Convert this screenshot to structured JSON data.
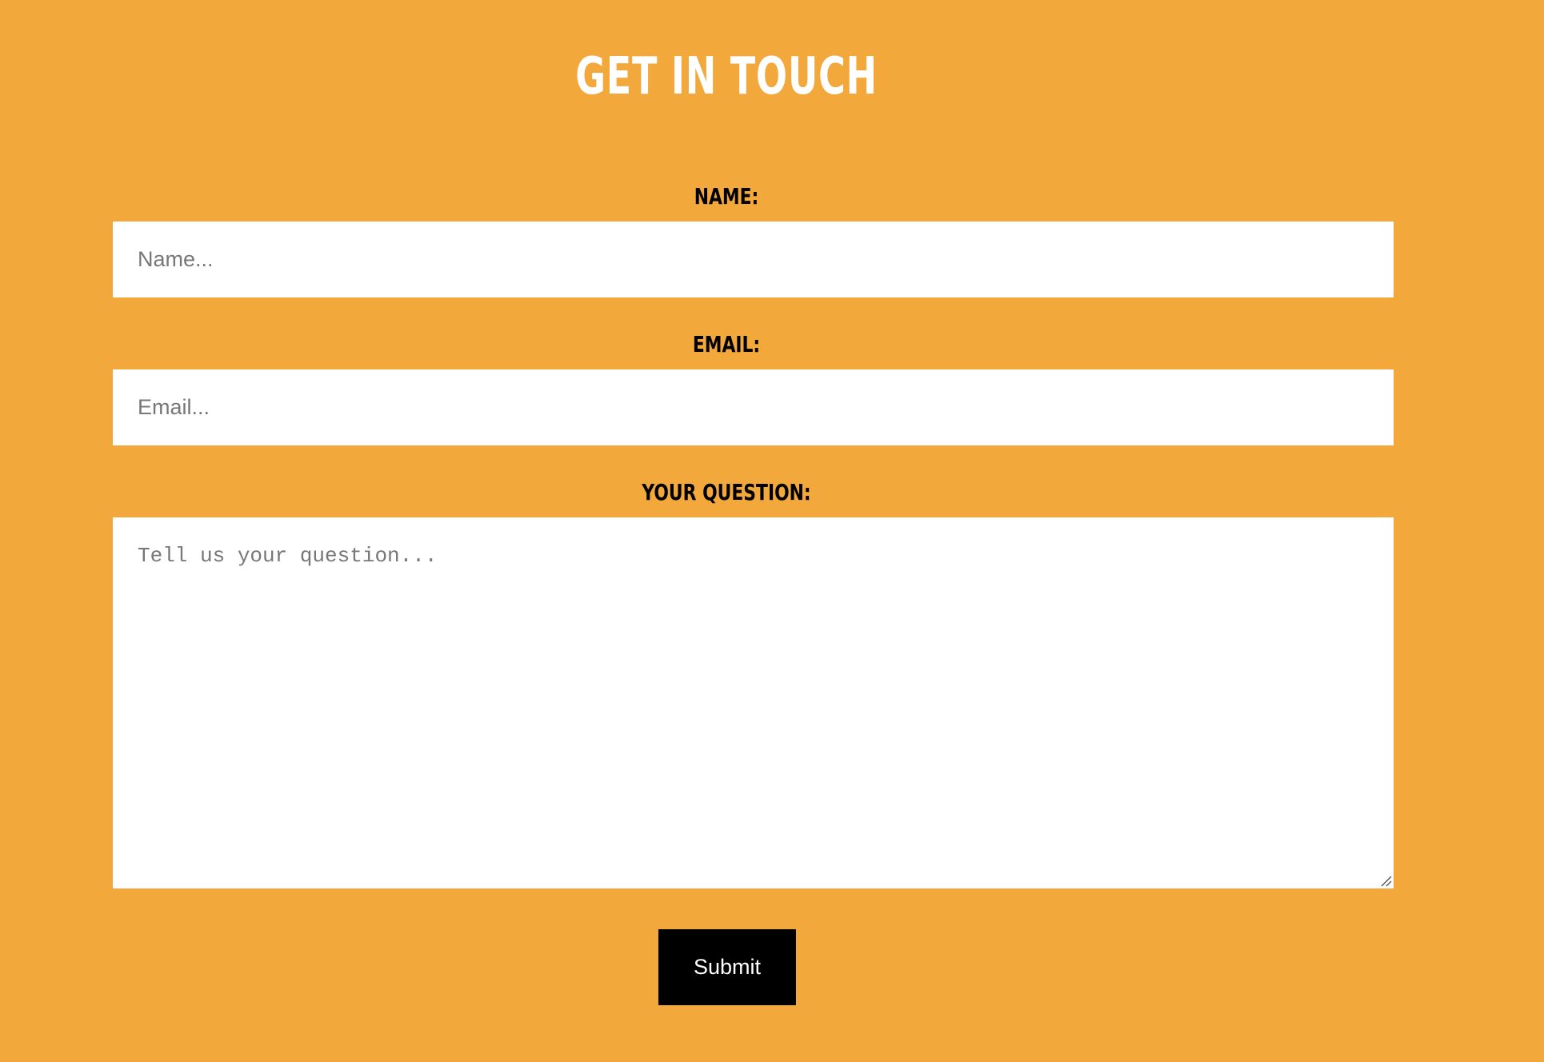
{
  "header": {
    "title": "GET IN TOUCH"
  },
  "form": {
    "name_label": "NAME:",
    "name_placeholder": "Name...",
    "email_label": "EMAIL:",
    "email_placeholder": "Email...",
    "question_label": "YOUR QUESTION:",
    "question_placeholder": "Tell us your question...",
    "submit_label": "Submit"
  },
  "icons": {
    "resize": "resize-grip-icon"
  },
  "colors": {
    "background": "#f2a83b",
    "title": "#ffffff",
    "label": "#000000",
    "field_background": "#ffffff",
    "button_background": "#000000",
    "button_text": "#ffffff",
    "placeholder": "#777777"
  }
}
